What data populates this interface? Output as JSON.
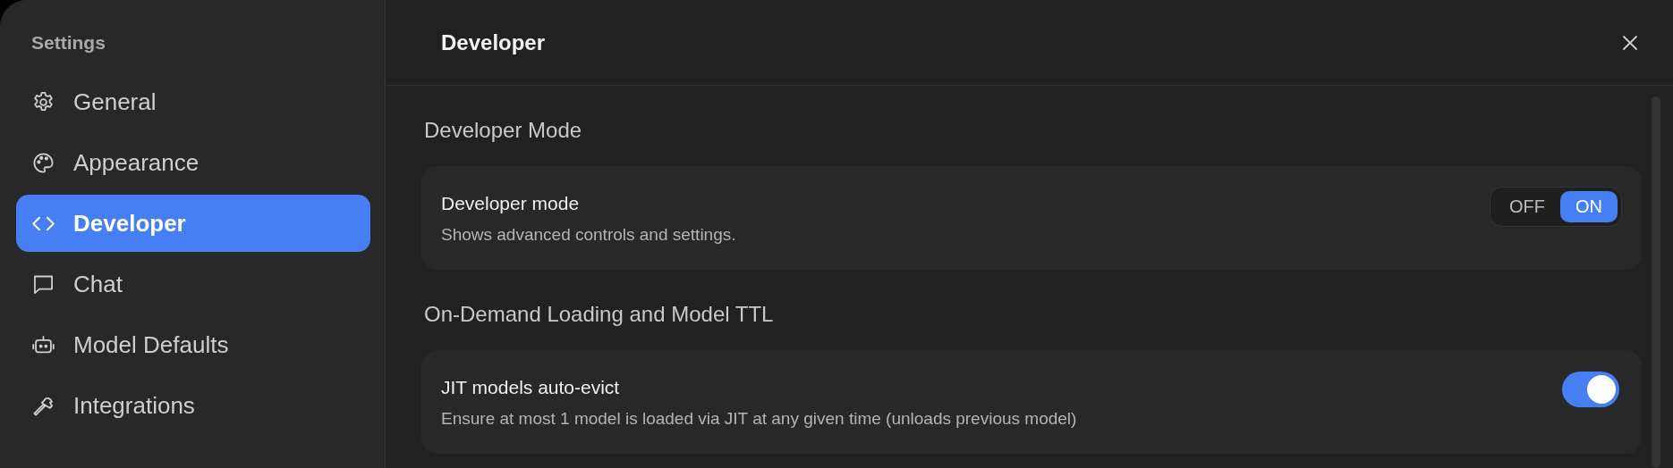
{
  "sidebar": {
    "title": "Settings",
    "items": [
      {
        "label": "General",
        "selected": false
      },
      {
        "label": "Appearance",
        "selected": false
      },
      {
        "label": "Developer",
        "selected": true
      },
      {
        "label": "Chat",
        "selected": false
      },
      {
        "label": "Model Defaults",
        "selected": false
      },
      {
        "label": "Integrations",
        "selected": false
      }
    ]
  },
  "header": {
    "title": "Developer"
  },
  "sections": [
    {
      "heading": "Developer Mode",
      "settings": [
        {
          "kind": "segmented",
          "label": "Developer mode",
          "description": "Shows advanced controls and settings.",
          "options": [
            {
              "label": "OFF",
              "selected": false
            },
            {
              "label": "ON",
              "selected": true
            }
          ]
        }
      ]
    },
    {
      "heading": "On-Demand Loading and Model TTL",
      "settings": [
        {
          "kind": "switch",
          "label": "JIT models auto-evict",
          "description": "Ensure at most 1 model is loaded via JIT at any given time (unloads previous model)",
          "on": true
        }
      ]
    }
  ]
}
